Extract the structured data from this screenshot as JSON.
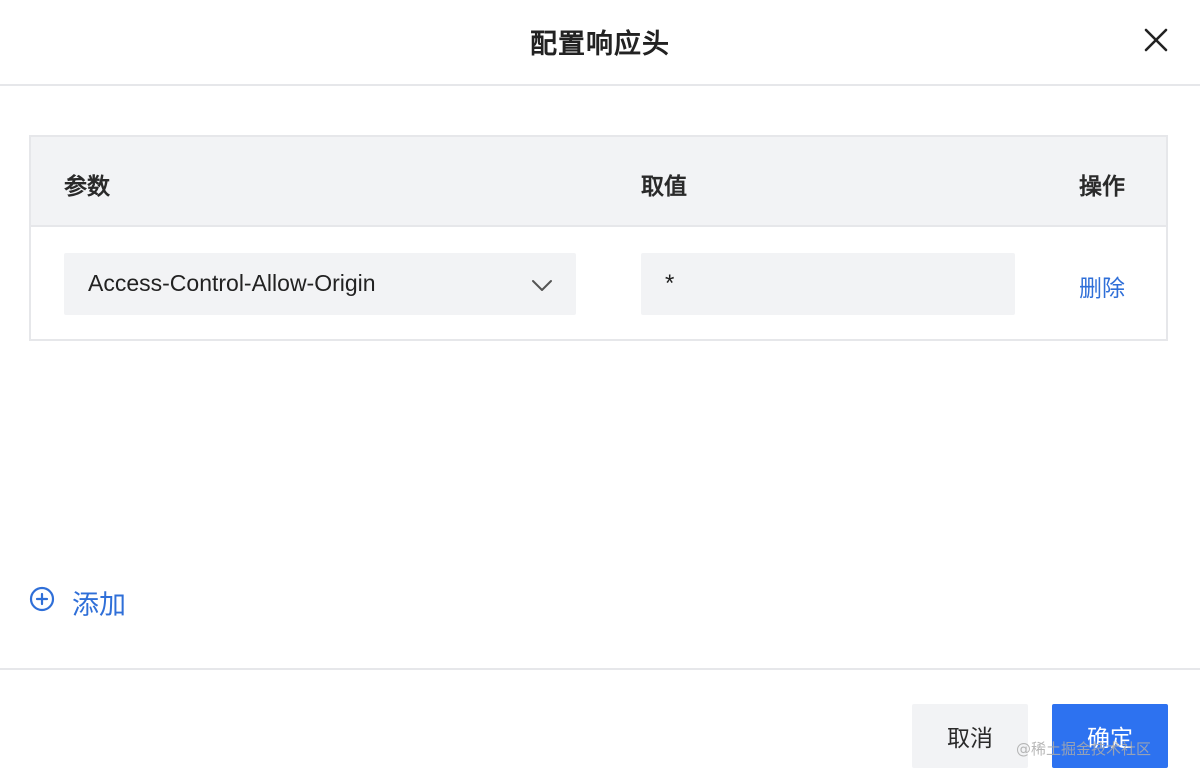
{
  "dialog": {
    "title": "配置响应头"
  },
  "table": {
    "columns": {
      "param": "参数",
      "value": "取值",
      "action": "操作"
    },
    "rows": [
      {
        "param": "Access-Control-Allow-Origin",
        "value": "*",
        "action": "删除"
      }
    ]
  },
  "add_label": "添加",
  "footer": {
    "cancel_label": "取消",
    "ok_label": "确定"
  },
  "watermark": "@稀土掘金技术社区",
  "colors": {
    "accent": "#2d72f0",
    "link": "#2f6fd8",
    "field_bg": "#f2f3f5",
    "border": "#e6e7ea"
  },
  "icons": {
    "close": "close-icon",
    "dropdown": "chevron-down-icon",
    "add": "plus-circle-icon"
  }
}
